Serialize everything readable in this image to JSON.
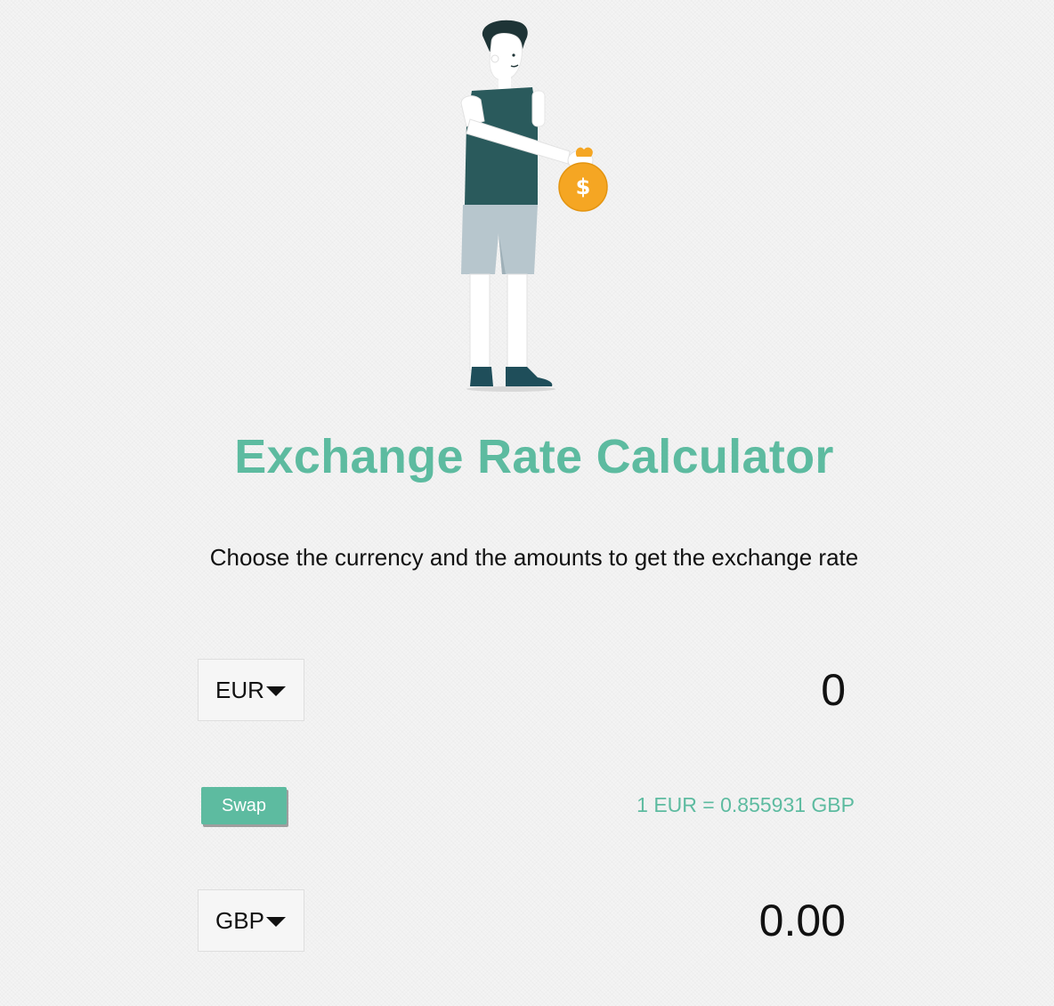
{
  "app": {
    "title": "Exchange Rate Calculator",
    "subtitle": "Choose the currency and the amounts to get the exchange rate"
  },
  "illustration": {
    "name": "man-holding-money-bag",
    "coin_symbol": "$"
  },
  "currency_one": {
    "code": "EUR",
    "amount": "0"
  },
  "currency_two": {
    "code": "GBP",
    "amount": "0.00"
  },
  "swap": {
    "label": "Swap"
  },
  "rate": {
    "text": "1 EUR = 0.855931 GBP"
  },
  "colors": {
    "accent": "#5dbba0",
    "background": "#f4f4f4",
    "text": "#111111",
    "coin": "#f5a623"
  }
}
